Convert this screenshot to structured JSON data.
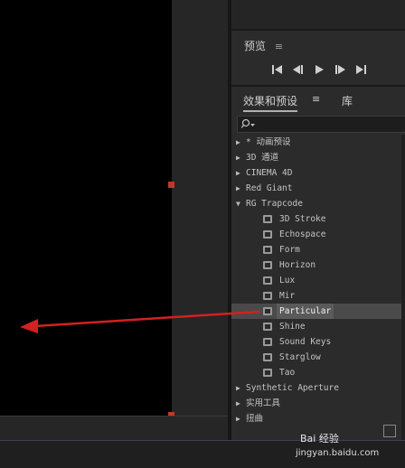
{
  "preview_panel": {
    "title": "预览",
    "menu_icon": "≡"
  },
  "effects_panel": {
    "tab_effects": "效果和预设",
    "tab_menu_icon": "≡",
    "tab_library": "库",
    "search_placeholder": ""
  },
  "tree": [
    {
      "label": "* 动画预设",
      "expanded": false
    },
    {
      "label": "3D 通道",
      "expanded": false
    },
    {
      "label": "CINEMA 4D",
      "expanded": false
    },
    {
      "label": "Red Giant",
      "expanded": false
    },
    {
      "label": "RG Trapcode",
      "expanded": true
    }
  ],
  "trapcode_children": [
    {
      "label": "3D Stroke"
    },
    {
      "label": "Echospace"
    },
    {
      "label": "Form"
    },
    {
      "label": "Horizon"
    },
    {
      "label": "Lux"
    },
    {
      "label": "Mir"
    },
    {
      "label": "Particular",
      "selected": true
    },
    {
      "label": "Shine"
    },
    {
      "label": "Sound Keys"
    },
    {
      "label": "Starglow"
    },
    {
      "label": "Tao"
    }
  ],
  "tree_after": [
    {
      "label": "Synthetic Aperture"
    },
    {
      "label": "实用工具"
    },
    {
      "label": "扭曲"
    }
  ],
  "watermark": {
    "line1": "Bai  经验",
    "line2": "jingyan.baidu.com"
  },
  "colors": {
    "annotation_arrow": "#d42020",
    "handle": "#c0392b"
  }
}
